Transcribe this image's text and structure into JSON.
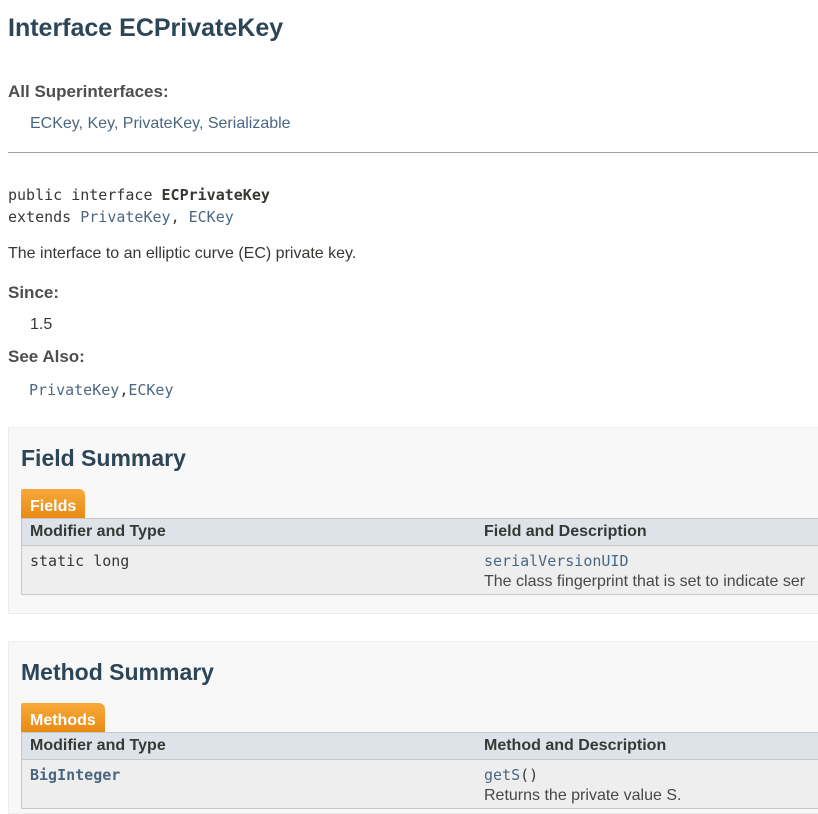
{
  "title": "Interface ECPrivateKey",
  "superinterfaces": {
    "label": "All Superinterfaces:",
    "items": [
      "ECKey",
      "Key",
      "PrivateKey",
      "Serializable"
    ]
  },
  "declaration": {
    "line1_prefix": "public interface ",
    "line1_name": "ECPrivateKey",
    "line2_prefix": "extends ",
    "line2_items": [
      "PrivateKey",
      "ECKey"
    ]
  },
  "description": "The interface to an elliptic curve (EC) private key.",
  "since": {
    "label": "Since:",
    "value": "1.5"
  },
  "see_also": {
    "label": "See Also:",
    "items": [
      "PrivateKey",
      "ECKey"
    ]
  },
  "field_summary": {
    "title": "Field Summary",
    "tab": "Fields",
    "col1": "Modifier and Type",
    "col2": "Field and Description",
    "rows": [
      {
        "type": "static long",
        "name": "serialVersionUID",
        "desc": "The class fingerprint that is set to indicate ser"
      }
    ]
  },
  "method_summary": {
    "title": "Method Summary",
    "tab": "Methods",
    "col1": "Modifier and Type",
    "col2": "Method and Description",
    "rows": [
      {
        "type": "BigInteger",
        "name": "getS",
        "params": "()",
        "desc": "Returns the private value S."
      }
    ]
  }
}
